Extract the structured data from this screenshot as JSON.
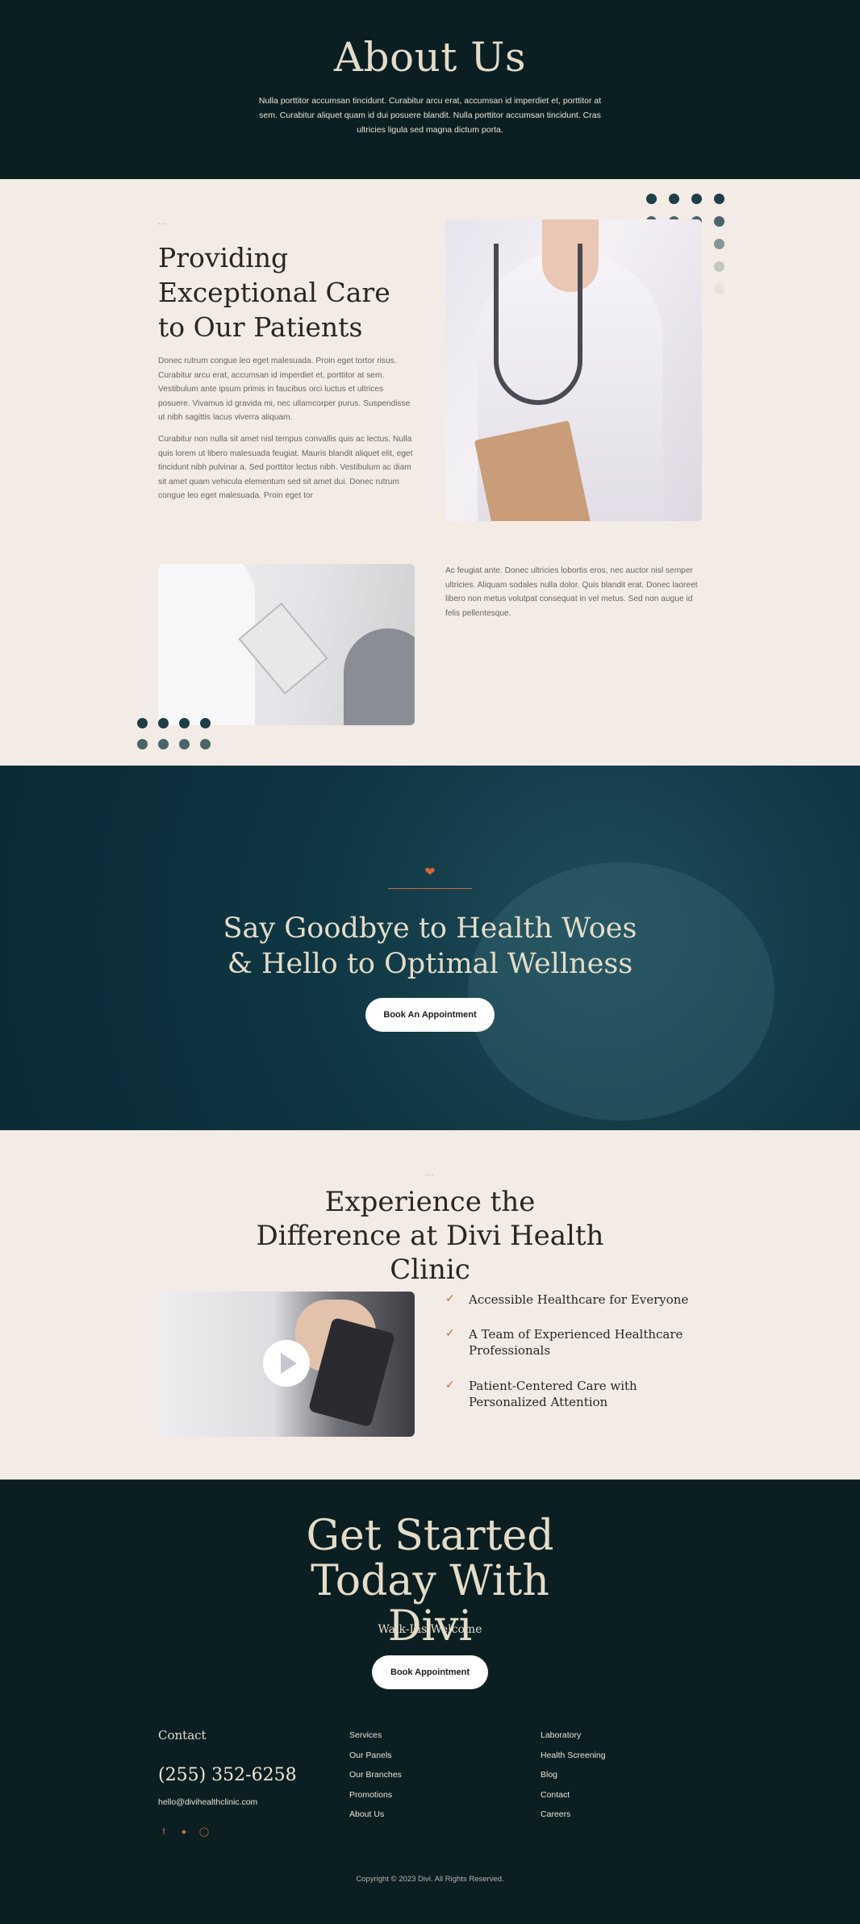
{
  "hero": {
    "title": "About Us",
    "text": "Nulla porttitor accumsan tincidunt. Curabitur arcu erat, accumsan id imperdiet et, porttitor at sem. Curabitur aliquet quam id dui posuere blandit. Nulla porttitor accumsan tincidunt. Cras ultricies ligula sed magna dictum porta."
  },
  "provide": {
    "accent_dots": "...",
    "title": "Providing Exceptional Care to Our Patients",
    "para1": "Donec rutrum congue leo eget malesuada. Proin eget tortor risus. Curabitur arcu erat, accumsan id imperdiet et, porttitor at sem. Vestibulum ante ipsum primis in faucibus orci luctus et ultrices posuere. Vivamus id gravida mi, nec ullamcorper purus. Suspendisse ut nibh sagittis lacus viverra aliquam.",
    "para2": "Curabitur non nulla sit amet nisl tempus convallis quis ac lectus. Nulla quis lorem ut libero malesuada feugiat. Mauris blandit aliquet elit, eget tincidunt nibh pulvinar a. Sed porttitor lectus nibh. Vestibulum ac diam sit amet quam vehicula elementum sed sit amet dui. Donec rutrum congue leo eget malesuada. Proin eget tor",
    "para3": "Ac feugiat ante. Donec ultricies lobortis eros, nec auctor nisl semper ultricies. Aliquam sodales nulla dolor. Quis blandit erat. Donec laoreet libero non metus volutpat consequat in vel metus. Sed non augue id felis pellentesque."
  },
  "banner": {
    "heart_icon": "heart-pulse-icon",
    "title": "Say Goodbye to Health Woes & Hello to Optimal Wellness",
    "button": "Book An Appointment"
  },
  "experience": {
    "accent_dots": "...",
    "title": "Experience the Difference at Divi Health Clinic",
    "play_icon": "play-icon",
    "checks": [
      "Accessible Healthcare for Everyone",
      "A Team of Experienced Healthcare Professionals",
      "Patient-Centered Care with Personalized Attention"
    ]
  },
  "footer": {
    "title": "Get Started Today With Divi",
    "subtitle": "Walk-Ins Welcome",
    "button": "Book Appointment",
    "contact_title": "Contact",
    "phone": "(255) 352-6258",
    "email": "hello@divihealthclinic.com",
    "social_icons": [
      "facebook-icon",
      "twitter-icon",
      "instagram-icon"
    ],
    "links_col1": [
      "Services",
      "Our Panels",
      "Our Branches",
      "Promotions",
      "About Us"
    ],
    "links_col2": [
      "Laboratory",
      "Health Screening",
      "Blog",
      "Contact",
      "Careers"
    ],
    "copyright": "Copyright © 2023 Divi. All Rights Reserved."
  },
  "colors": {
    "dark": "#0b1f22",
    "cream": "#f3ebe5",
    "accent": "#c86a3a",
    "heading_light": "#e4dcc9"
  }
}
